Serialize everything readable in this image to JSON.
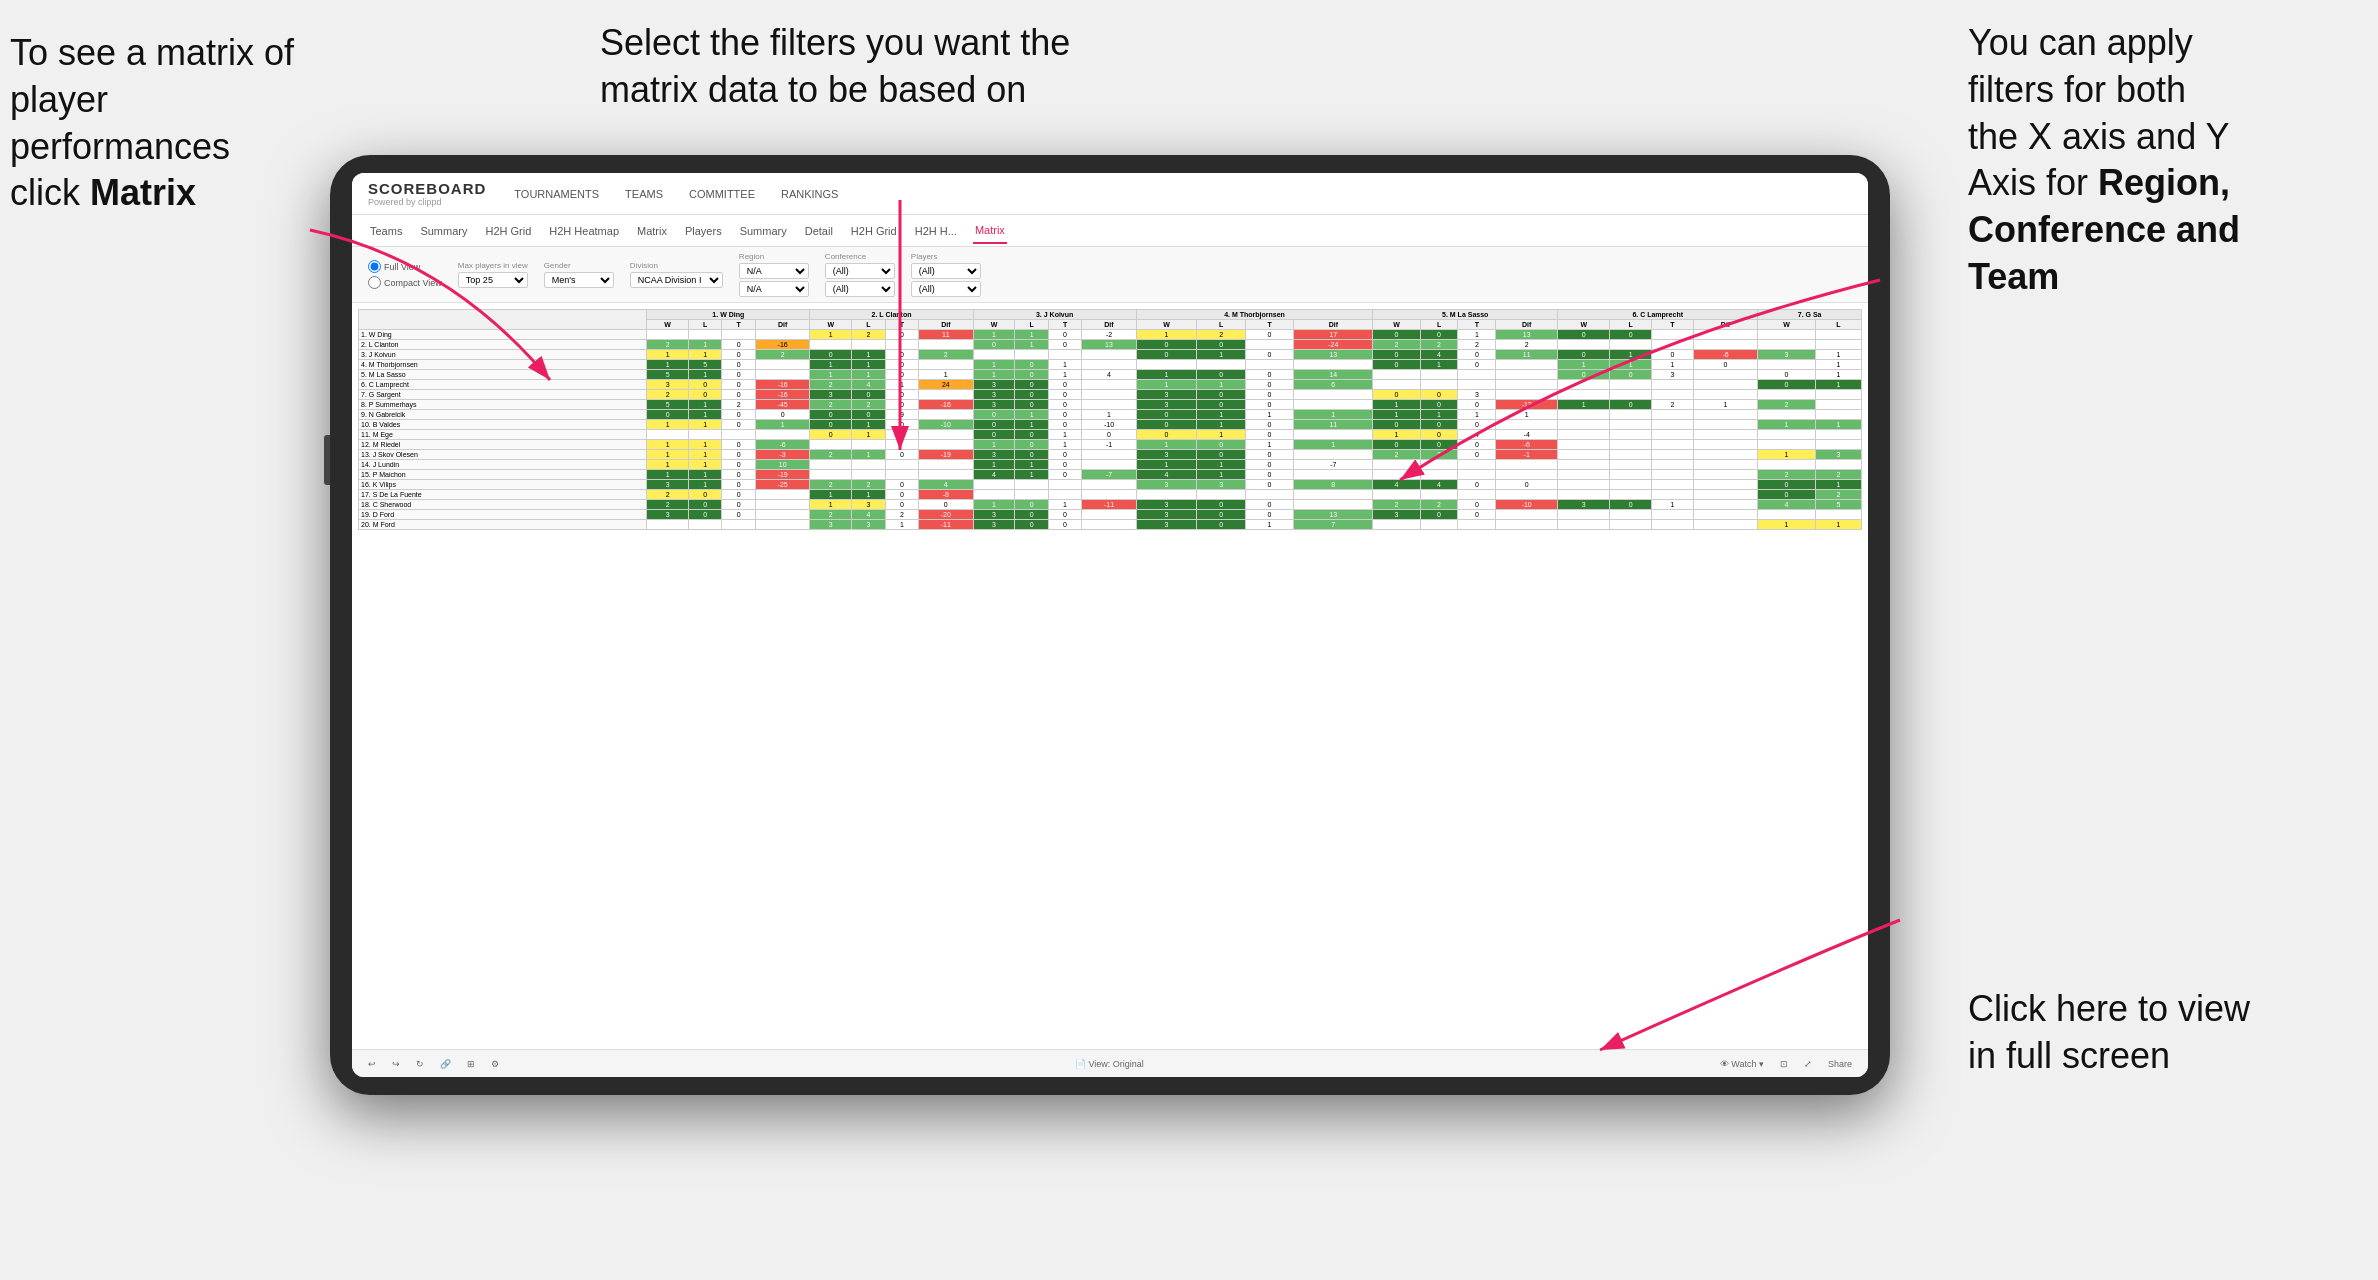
{
  "annotations": {
    "matrix": {
      "line1": "To see a matrix of",
      "line2": "player performances",
      "line3_plain": "click ",
      "line3_bold": "Matrix"
    },
    "filters": {
      "text": "Select the filters you want the matrix data to be based on"
    },
    "axes": {
      "line1": "You  can apply",
      "line2": "filters for both",
      "line3": "the X axis and Y",
      "line4_plain": "Axis for ",
      "line4_bold": "Region,",
      "line5_bold": "Conference and",
      "line6_bold": "Team"
    },
    "fullscreen": {
      "line1": "Click here to view",
      "line2": "in full screen"
    }
  },
  "app": {
    "logo_title": "SCOREBOARD",
    "logo_subtitle": "Powered by clippd",
    "nav": [
      "TOURNAMENTS",
      "TEAMS",
      "COMMITTEE",
      "RANKINGS"
    ],
    "subnav": [
      "Teams",
      "Summary",
      "H2H Grid",
      "H2H Heatmap",
      "Matrix",
      "Players",
      "Summary",
      "Detail",
      "H2H Grid",
      "H2H H...",
      "Matrix"
    ],
    "active_tab": "Matrix"
  },
  "filters": {
    "view_options": [
      "Full View",
      "Compact View"
    ],
    "labels": [
      "Max players in view",
      "Gender",
      "Division",
      "Region",
      "Conference",
      "Players"
    ],
    "values": [
      "Top 25",
      "Men's",
      "NCAA Division I",
      "N/A",
      "(All)",
      "(All)"
    ],
    "region_sub": "N/A",
    "conference_sub": "(All)",
    "players_sub": "(All)"
  },
  "matrix": {
    "col_headers": [
      "1. W Ding",
      "2. L Clanton",
      "3. J Koivun",
      "4. M Thorbjornsen",
      "5. M La Sasso",
      "6. C Lamprecht",
      "7. G Sa"
    ],
    "sub_headers": [
      "W",
      "L",
      "T",
      "Dif"
    ],
    "rows": [
      {
        "name": "1. W Ding",
        "data": ""
      },
      {
        "name": "2. L Clanton",
        "data": ""
      },
      {
        "name": "3. J Koivun",
        "data": ""
      },
      {
        "name": "4. M Thorbjornsen",
        "data": ""
      },
      {
        "name": "5. M La Sasso",
        "data": ""
      },
      {
        "name": "6. C Lamprecht",
        "data": ""
      },
      {
        "name": "7. G Sargent",
        "data": ""
      },
      {
        "name": "8. P Summerhays",
        "data": ""
      },
      {
        "name": "9. N Gabrelcik",
        "data": ""
      },
      {
        "name": "10. B Valdes",
        "data": ""
      },
      {
        "name": "11. M Ege",
        "data": ""
      },
      {
        "name": "12. M Riedel",
        "data": ""
      },
      {
        "name": "13. J Skov Olesen",
        "data": ""
      },
      {
        "name": "14. J Lundin",
        "data": ""
      },
      {
        "name": "15. P Maichon",
        "data": ""
      },
      {
        "name": "16. K Vilips",
        "data": ""
      },
      {
        "name": "17. S De La Fuente",
        "data": ""
      },
      {
        "name": "18. C Sherwood",
        "data": ""
      },
      {
        "name": "19. D Ford",
        "data": ""
      },
      {
        "name": "20. M Ford",
        "data": ""
      }
    ]
  },
  "toolbar": {
    "view_label": "View: Original",
    "watch_label": "Watch ▾",
    "share_label": "Share"
  }
}
